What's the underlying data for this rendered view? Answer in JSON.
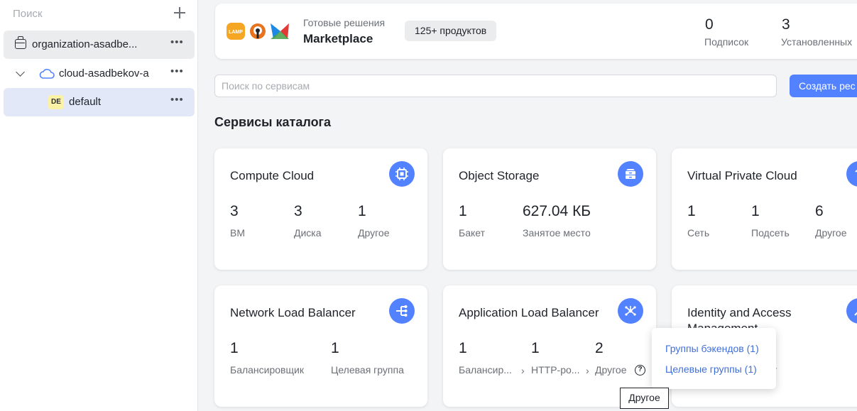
{
  "sidebar": {
    "search_placeholder": "Поиск",
    "items": [
      {
        "label": "organization-asadbe..."
      },
      {
        "label": "cloud-asadbekov-a"
      },
      {
        "label": "default",
        "badge": "DE"
      }
    ]
  },
  "marketplace": {
    "subtitle": "Готовые решения",
    "title": "Marketplace",
    "badge": "125+ продуктов",
    "logo_text": "LAMP",
    "stats": [
      {
        "value": "0",
        "label": "Подписок"
      },
      {
        "value": "3",
        "label": "Установленных"
      }
    ]
  },
  "search": {
    "placeholder": "Поиск по сервисам"
  },
  "create_button": "Создать рес",
  "section_title": "Сервисы каталога",
  "services": [
    {
      "title": "Compute Cloud",
      "icon": "chip-icon",
      "stats": [
        {
          "value": "3",
          "label": "ВМ"
        },
        {
          "value": "3",
          "label": "Диска"
        },
        {
          "value": "1",
          "label": "Другое"
        }
      ]
    },
    {
      "title": "Object Storage",
      "icon": "storage-icon",
      "stats": [
        {
          "value": "1",
          "label": "Бакет"
        },
        {
          "value": "627.04 КБ",
          "label": "Занятое место"
        }
      ]
    },
    {
      "title": "Virtual Private Cloud",
      "icon": "network-icon",
      "stats": [
        {
          "value": "1",
          "label": "Сеть"
        },
        {
          "value": "1",
          "label": "Подсеть"
        },
        {
          "value": "6",
          "label": "Другое"
        }
      ]
    },
    {
      "title": "Network Load Balancer",
      "icon": "balancer-icon",
      "stats": [
        {
          "value": "1",
          "label": "Балансировщик"
        },
        {
          "value": "1",
          "label": "Целевая группа"
        }
      ]
    },
    {
      "title": "Application Load Balancer",
      "icon": "alb-icon",
      "stats": [
        {
          "value": "1",
          "label": "Балансир..."
        },
        {
          "value": "1",
          "label": "HTTP-ро..."
        },
        {
          "value": "2",
          "label": "Другое"
        }
      ]
    },
    {
      "title": "Identity and Access Management",
      "icon": "iam-icon",
      "stats": [
        {
          "value": "",
          "label": "т"
        }
      ]
    }
  ],
  "popup": {
    "items": [
      "Группы бэкендов (1)",
      "Целевые группы (1)"
    ]
  },
  "tooltip": "Другое",
  "colors": {
    "accent": "#5282ff",
    "link": "#3f6fd8",
    "selected_row": "#e2e8f8"
  }
}
